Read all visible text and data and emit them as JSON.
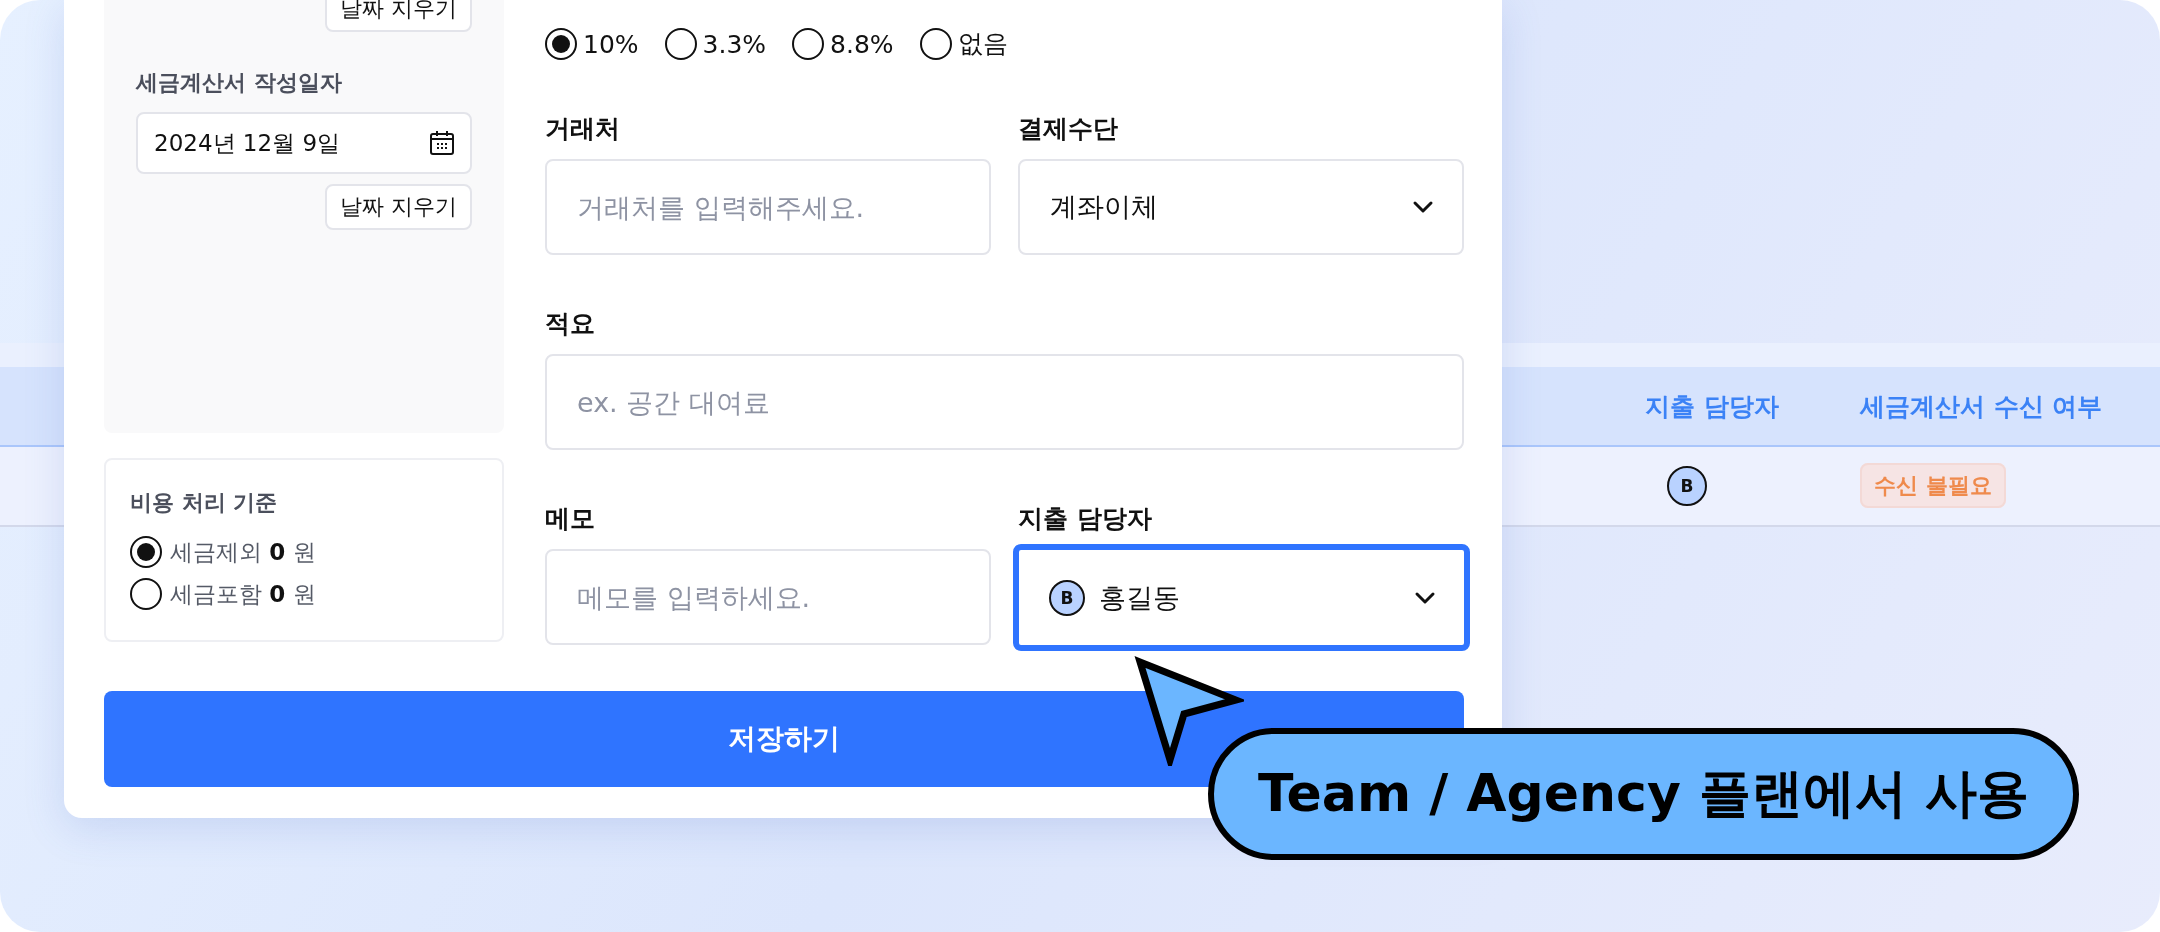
{
  "background_table": {
    "columns": [
      {
        "label": "지출 담당자"
      },
      {
        "label": "세금계산서 수신 여부"
      }
    ],
    "rows": [
      {
        "manager_initial": "B",
        "tax_invoice_status": "수신 불필요"
      }
    ]
  },
  "date_panel": {
    "top_clear_button": "날짜 지우기",
    "invoice_date_label": "세금계산서 작성일자",
    "invoice_date": "2024년 12월 9일",
    "clear_button": "날짜 지우기"
  },
  "cost_basis": {
    "title": "비용 처리 기준",
    "options": [
      {
        "label": "세금제외",
        "amount": "0",
        "unit": "원",
        "selected": true
      },
      {
        "label": "세금포함",
        "amount": "0",
        "unit": "원",
        "selected": false
      }
    ]
  },
  "tax_rates": [
    {
      "label": "10%",
      "selected": true
    },
    {
      "label": "3.3%",
      "selected": false
    },
    {
      "label": "8.8%",
      "selected": false
    },
    {
      "label": "없음",
      "selected": false
    }
  ],
  "fields": [
    {
      "kind": "input",
      "label": "거래처",
      "placeholder": "거래처를 입력해주세요."
    },
    {
      "kind": "select",
      "label": "결제수단",
      "value": "계좌이체"
    },
    {
      "kind": "wide_input",
      "label": "적요",
      "placeholder": "ex. 공간 대여료"
    },
    {
      "kind": "input",
      "label": "메모",
      "placeholder": "메모를 입력하세요."
    },
    {
      "kind": "person_select",
      "label": "지출 담당자",
      "initial": "B",
      "value": "홍길동",
      "focused": true
    }
  ],
  "save_button": "저장하기",
  "callout": "Team / Agency 플랜에서 사용"
}
